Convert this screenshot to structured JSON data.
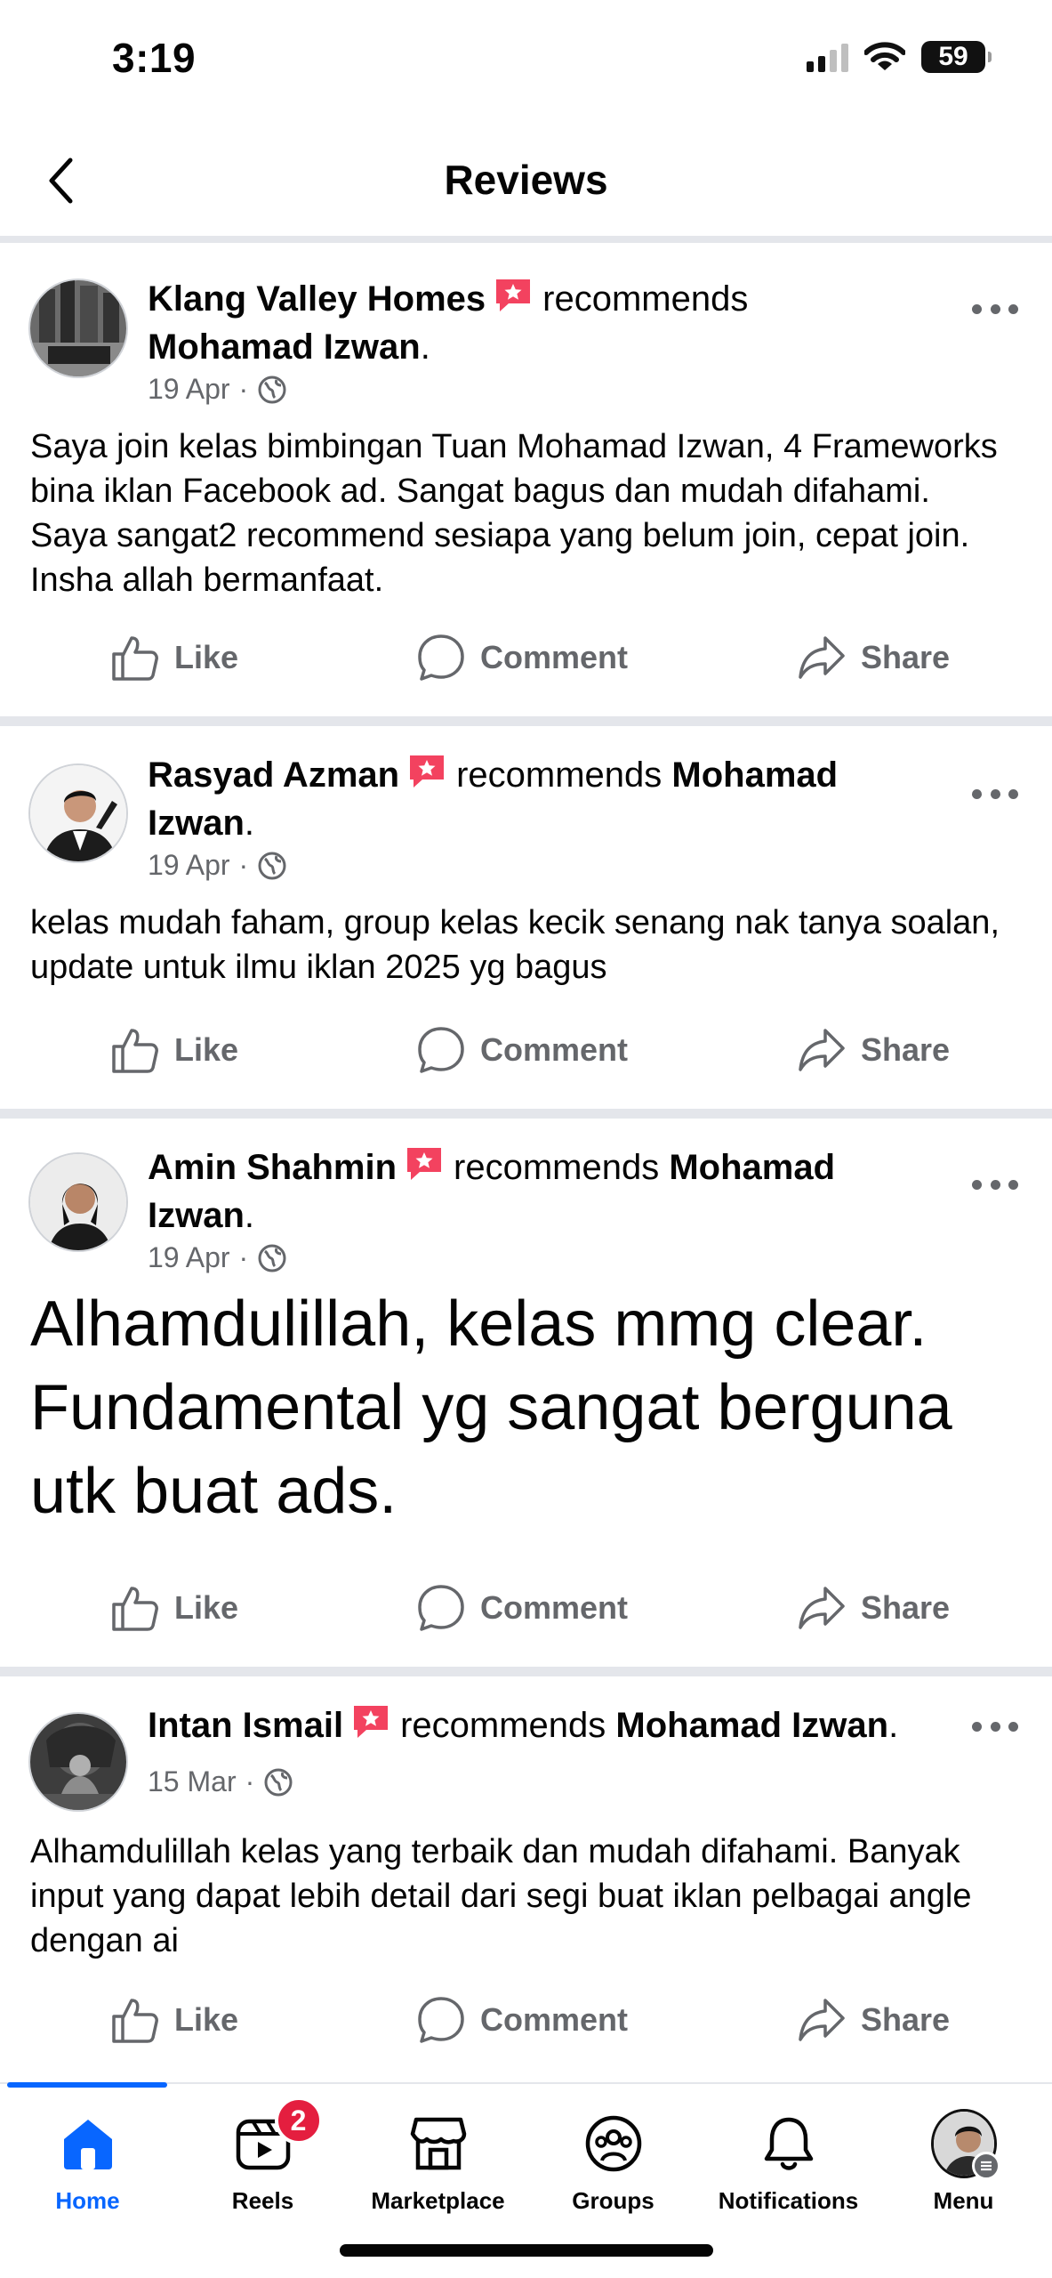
{
  "status": {
    "time": "3:19",
    "battery": "59"
  },
  "header": {
    "title": "Reviews"
  },
  "posts": [
    {
      "author": "Klang Valley Homes",
      "verb": "recommends",
      "target": "Mohamad Izwan",
      "date": "19 Apr",
      "body": "Saya join kelas bimbingan Tuan Mohamad Izwan, 4 Frameworks bina iklan Facebook ad. Sangat bagus dan mudah difahami. Saya sangat2 recommend sesiapa yang belum join, cepat join. Insha allah bermanfaat."
    },
    {
      "author": "Rasyad Azman",
      "verb": "recommends",
      "target": "Mohamad Izwan",
      "date": "19 Apr",
      "body": "kelas mudah faham, group kelas kecik senang nak tanya soalan, update untuk ilmu iklan 2025 yg bagus"
    },
    {
      "author": "Amin Shahmin",
      "verb": "recommends",
      "target": "Mohamad Izwan",
      "date": "19 Apr",
      "body": "Alhamdulillah, kelas mmg clear. Fundamental yg sangat berguna utk buat ads."
    },
    {
      "author": "Intan Ismail",
      "verb": "recommends",
      "target": "Mohamad Izwan",
      "date": "15 Mar",
      "body": "Alhamdulillah kelas yang terbaik dan mudah difahami. Banyak input yang dapat lebih detail dari segi buat iklan pelbagai angle dengan ai"
    }
  ],
  "actions": {
    "like": "Like",
    "comment": "Comment",
    "share": "Share"
  },
  "nav": {
    "home": "Home",
    "reels": "Reels",
    "reels_badge": "2",
    "marketplace": "Marketplace",
    "groups": "Groups",
    "notifications": "Notifications",
    "menu": "Menu"
  },
  "colors": {
    "accent": "#0866ff",
    "badge": "#e41e3f",
    "recommend_icon": "#f3425f"
  }
}
